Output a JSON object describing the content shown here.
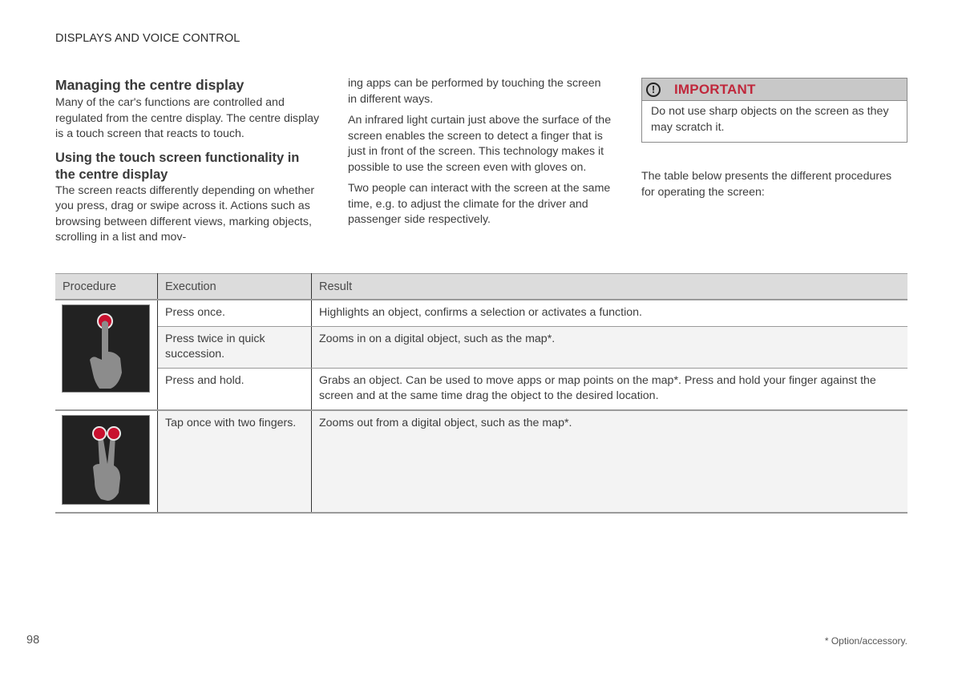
{
  "header": {
    "running_head": "DISPLAYS AND VOICE CONTROL"
  },
  "col1": {
    "title": "Managing the centre display",
    "intro": "Many of the car's functions are controlled and regulated from the centre display. The centre display is a touch screen that reacts to touch.",
    "subtitle": "Using the touch screen functionality in the centre display",
    "para": "The screen reacts differently depending on whether you press, drag or swipe across it. Actions such as browsing between different views, marking objects, scrolling in a list and mov-"
  },
  "col2": {
    "para1": "ing apps can be performed by touching the screen in different ways.",
    "para2": "An infrared light curtain just above the surface of the screen enables the screen to detect a finger that is just in front of the screen. This technology makes it possible to use the screen even with gloves on.",
    "para3": "Two people can interact with the screen at the same time, e.g. to adjust the climate for the driver and passenger side respectively."
  },
  "col3": {
    "important": {
      "icon": "exclamation-circle-icon",
      "title": "IMPORTANT",
      "text": "Do not use sharp objects on the screen as they may scratch it.",
      "title_color": "#c0283c"
    },
    "intro": "The table below presents the different procedures for operating the screen:"
  },
  "table": {
    "headers": [
      "Procedure",
      "Execution",
      "Result"
    ],
    "groups": [
      {
        "illustration": "one-finger-tap-icon",
        "rows": [
          {
            "execution": "Press once.",
            "result": "Highlights an object, confirms a selection or activates a function."
          },
          {
            "execution": "Press twice in quick succession.",
            "result": "Zooms in on a digital object, such as the map*."
          },
          {
            "execution": "Press and hold.",
            "result": "Grabs an object. Can be used to move apps or map points on the map*. Press and hold your finger against the screen and at the same time drag the object to the desired location."
          }
        ]
      },
      {
        "illustration": "two-finger-tap-icon",
        "rows": [
          {
            "execution": "Tap once with two fingers.",
            "result": "Zooms out from a digital object, such as the map*."
          }
        ]
      }
    ]
  },
  "footer": {
    "page_number": "98",
    "footnote": "* Option/accessory."
  },
  "colors": {
    "accent_red": "#c0283c",
    "touch_dot": "#c8102e",
    "illustration_bg": "#222222",
    "hand": "#8c8c8c"
  }
}
